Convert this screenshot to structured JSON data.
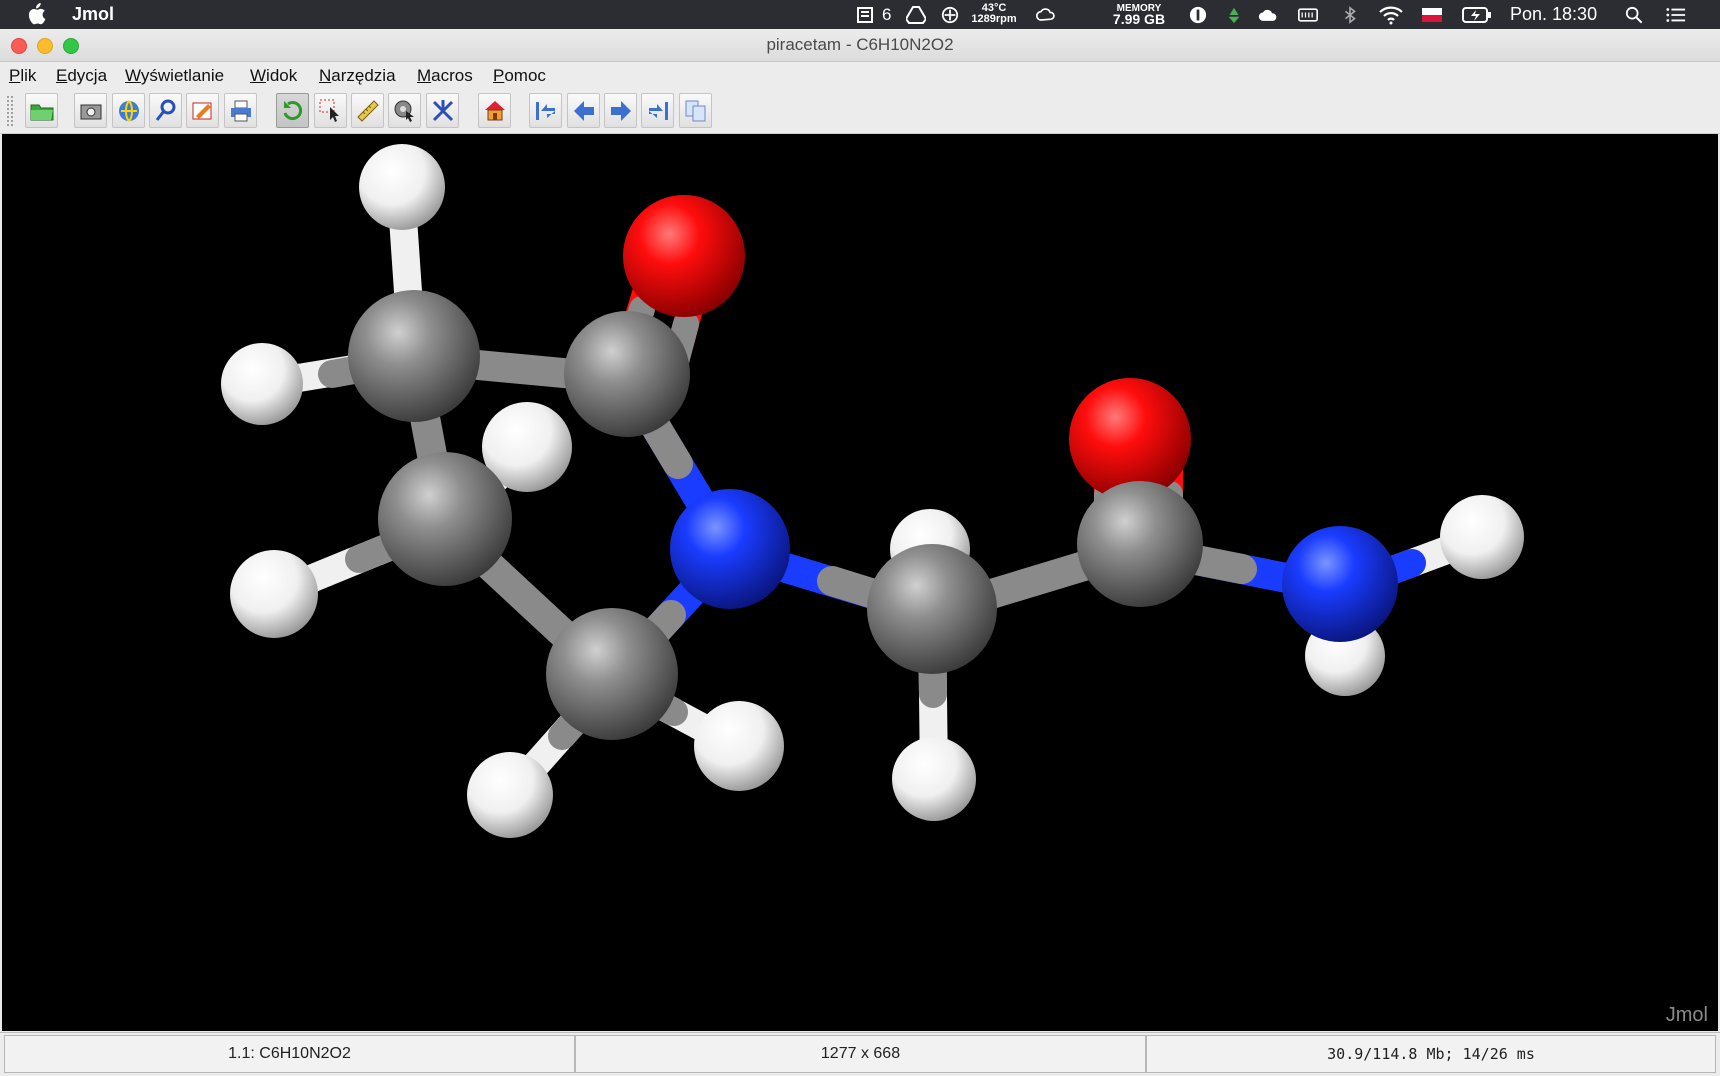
{
  "system_menubar": {
    "app_name": "Jmol",
    "notifications_count": "6",
    "temperature": "43°C",
    "fan_speed": "1289rpm",
    "memory_label": "MEMORY",
    "memory_value": "7.99 GB",
    "clock": "Pon. 18:30",
    "icons": [
      "apple-icon",
      "stack-icon",
      "drive-icon",
      "fan-icon",
      "creative-cloud-icon",
      "onepassword-icon",
      "recycle-icon",
      "cloud-icon",
      "keyboard-icon",
      "bluetooth-icon",
      "wifi-icon",
      "flag-icon",
      "battery-icon",
      "search-icon",
      "list-icon"
    ]
  },
  "window": {
    "title": "piracetam - C6H10N2O2"
  },
  "menu": {
    "items": [
      {
        "first": "P",
        "rest": "lik"
      },
      {
        "first": "E",
        "rest": "dycja"
      },
      {
        "first": "W",
        "rest": "yświetlanie"
      },
      {
        "first": "W",
        "rest": "idok"
      },
      {
        "first": "N",
        "rest": "arzędzia"
      },
      {
        "first": "M",
        "rest": "acros"
      },
      {
        "first": "P",
        "rest": "omoc"
      }
    ]
  },
  "toolbar": {
    "buttons": [
      "open-file",
      "screenshot",
      "www",
      "spyglass",
      "edit-script",
      "print",
      "rotate",
      "select",
      "measure",
      "pick-center",
      "perspective",
      "home",
      "first-frame",
      "previous-frame",
      "next-frame",
      "last-frame",
      "copy"
    ]
  },
  "viewer": {
    "watermark": "Jmol",
    "colors": {
      "carbon": "#8a8a8a",
      "hydrogen": "#ffffff",
      "oxygen": "#ff0d0d",
      "nitrogen": "#1a3cff",
      "background": "#000000"
    }
  },
  "status": {
    "model": "1.1: C6H10N2O2",
    "dimensions": "1277 x 668",
    "memory_timing": "30.9/114.8 Mb;  14/26 ms"
  }
}
